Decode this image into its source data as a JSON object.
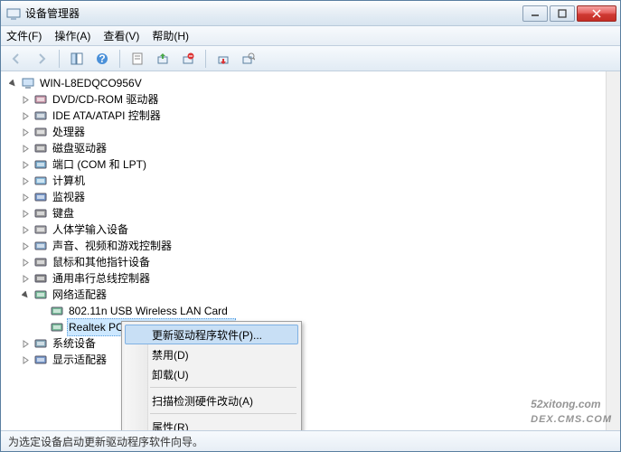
{
  "window": {
    "title": "设备管理器"
  },
  "menubar": {
    "file": "文件(F)",
    "action": "操作(A)",
    "view": "查看(V)",
    "help": "帮助(H)"
  },
  "tree": {
    "root": "WIN-L8EDQCO956V",
    "items": [
      {
        "label": "DVD/CD-ROM 驱动器",
        "icon": "disc-icon",
        "expanded": false
      },
      {
        "label": "IDE ATA/ATAPI 控制器",
        "icon": "ide-icon",
        "expanded": false
      },
      {
        "label": "处理器",
        "icon": "cpu-icon",
        "expanded": false
      },
      {
        "label": "磁盘驱动器",
        "icon": "disk-icon",
        "expanded": false
      },
      {
        "label": "端口 (COM 和 LPT)",
        "icon": "port-icon",
        "expanded": false
      },
      {
        "label": "计算机",
        "icon": "computer-icon",
        "expanded": false
      },
      {
        "label": "监视器",
        "icon": "monitor-icon",
        "expanded": false
      },
      {
        "label": "键盘",
        "icon": "keyboard-icon",
        "expanded": false
      },
      {
        "label": "人体学输入设备",
        "icon": "hid-icon",
        "expanded": false
      },
      {
        "label": "声音、视频和游戏控制器",
        "icon": "sound-icon",
        "expanded": false
      },
      {
        "label": "鼠标和其他指针设备",
        "icon": "mouse-icon",
        "expanded": false
      },
      {
        "label": "通用串行总线控制器",
        "icon": "usb-icon",
        "expanded": false
      },
      {
        "label": "网络适配器",
        "icon": "network-icon",
        "expanded": true,
        "children": [
          {
            "label": "802.11n USB Wireless LAN Card",
            "icon": "netcard-icon"
          },
          {
            "label": "Realtek PCIe FE Family Controller",
            "icon": "netcard-icon",
            "selected": true
          }
        ]
      },
      {
        "label": "系统设备",
        "icon": "system-icon",
        "expanded": false
      },
      {
        "label": "显示适配器",
        "icon": "display-icon",
        "expanded": false
      }
    ]
  },
  "context_menu": {
    "update": "更新驱动程序软件(P)...",
    "disable": "禁用(D)",
    "uninstall": "卸载(U)",
    "scan": "扫描检测硬件改动(A)",
    "properties": "属性(R)"
  },
  "statusbar": {
    "text": "为选定设备启动更新驱动程序软件向导。"
  },
  "watermark": {
    "main": "52xitong.com",
    "sub": "DEX.CMS.COM"
  }
}
